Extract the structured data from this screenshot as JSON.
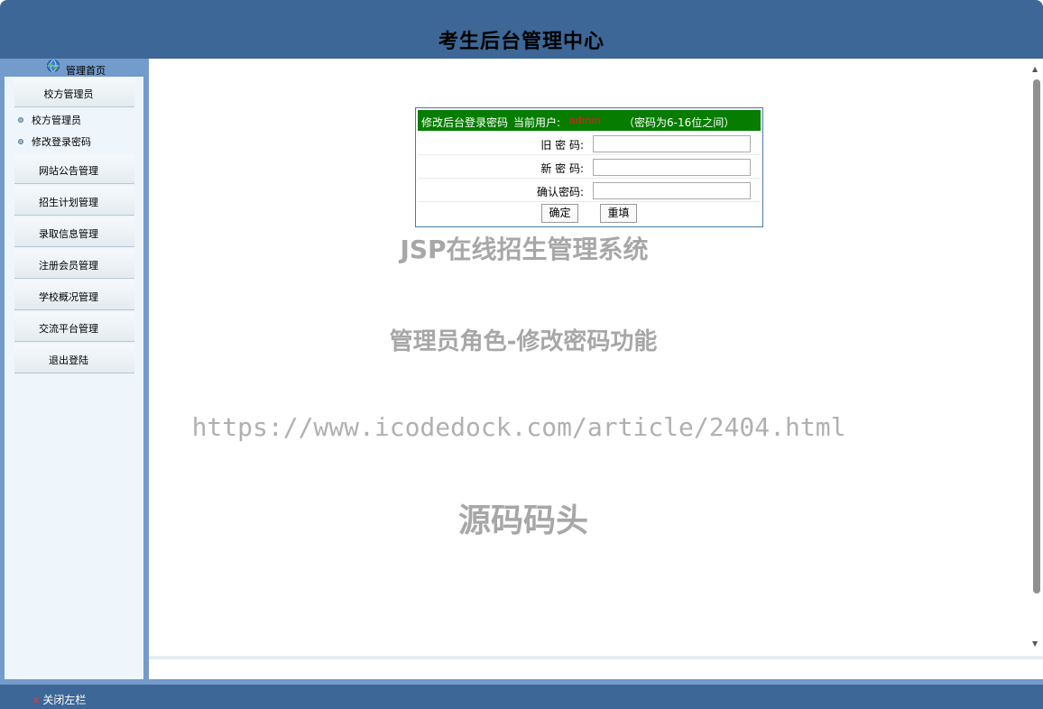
{
  "header": {
    "title": "考生后台管理中心"
  },
  "sidebar": {
    "home_label": "管理首页",
    "sections": [
      {
        "label": "校方管理员"
      },
      {
        "label": "网站公告管理"
      },
      {
        "label": "招生计划管理"
      },
      {
        "label": "录取信息管理"
      },
      {
        "label": "注册会员管理"
      },
      {
        "label": "学校概况管理"
      },
      {
        "label": "交流平台管理"
      },
      {
        "label": "退出登陆"
      }
    ],
    "sub_items": [
      {
        "label": "校方管理员"
      },
      {
        "label": "修改登录密码"
      }
    ]
  },
  "form": {
    "title": "修改后台登录密码",
    "user_label": "当前用户:",
    "user_value": "admin",
    "hint": "（密码为6-16位之间）",
    "fields": [
      {
        "label": "旧 密 码:",
        "value": ""
      },
      {
        "label": "新 密 码:",
        "value": ""
      },
      {
        "label": "确认密码:",
        "value": ""
      }
    ],
    "submit_label": "确定",
    "reset_label": "重填"
  },
  "watermarks": [
    "JSP在线招生管理系统",
    "管理员角色-修改密码功能",
    "https://www.icodedock.com/article/2404.html",
    "源码码头"
  ],
  "footer": {
    "close_label": "关闭左栏"
  },
  "colors": {
    "header_bg": "#3d6796",
    "frame_bg": "#739bcb",
    "sidebar_bg": "#eef6fc",
    "form_head_bg": "#067d00",
    "watermark": "#a7a7a7"
  }
}
